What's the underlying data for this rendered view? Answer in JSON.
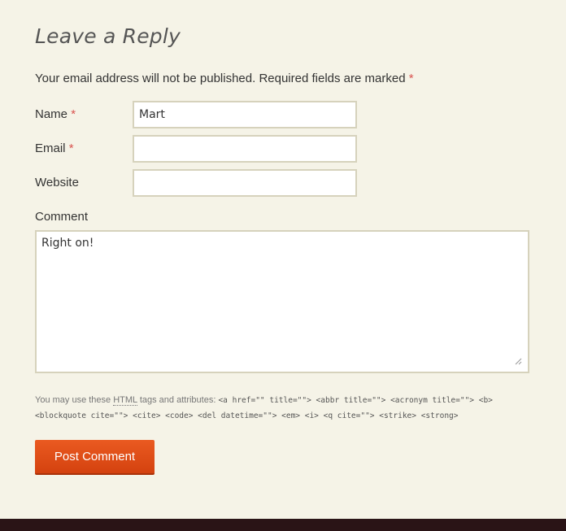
{
  "reply": {
    "title": "Leave a Reply",
    "notes": "Your email address will not be published. Required fields are marked",
    "required_mark": "*"
  },
  "fields": {
    "name": {
      "label": "Name",
      "value": "Mart"
    },
    "email": {
      "label": "Email",
      "value": ""
    },
    "website": {
      "label": "Website",
      "value": ""
    },
    "comment": {
      "label": "Comment",
      "value": "Right on!"
    }
  },
  "allowed_tags": {
    "prefix": "You may use these",
    "abbr": "HTML",
    "middle": "tags and attributes:",
    "code": "<a href=\"\" title=\"\"> <abbr title=\"\"> <acronym title=\"\"> <b> <blockquote cite=\"\"> <cite> <code> <del datetime=\"\"> <em> <i> <q cite=\"\"> <strike> <strong>"
  },
  "submit": {
    "label": "Post Comment"
  },
  "colors": {
    "background": "#f5f3e7",
    "accent": "#e04f18",
    "required": "#d9534f",
    "footer": "#2a1416"
  }
}
